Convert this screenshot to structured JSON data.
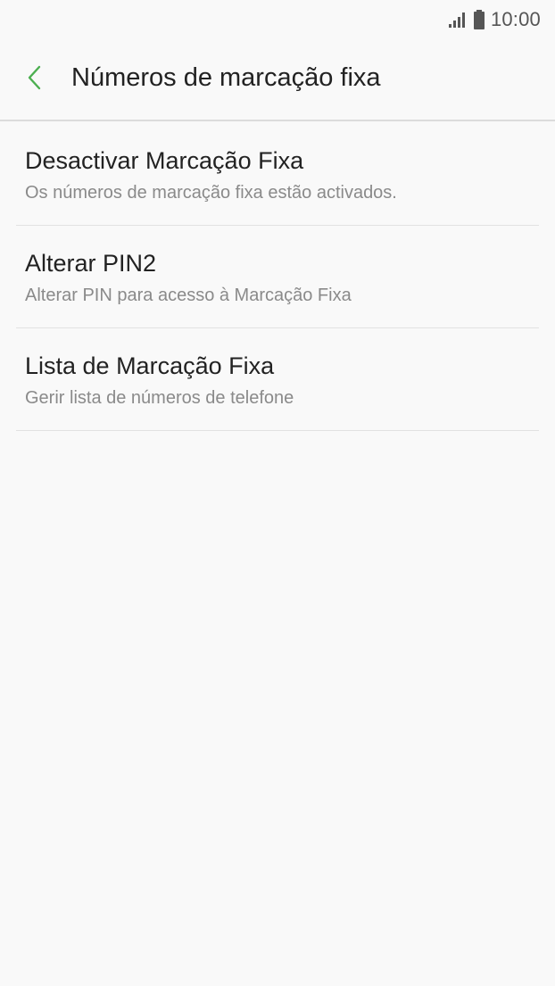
{
  "status_bar": {
    "time": "10:00",
    "signal_icon": "signal-icon",
    "battery_icon": "battery-icon"
  },
  "header": {
    "back_icon": "chevron-left-icon",
    "title": "Números de marcação fixa",
    "accent_color": "#4caf50"
  },
  "items": [
    {
      "title": "Desactivar Marcação Fixa",
      "subtitle": "Os números de marcação fixa estão activados."
    },
    {
      "title": "Alterar PIN2",
      "subtitle": "Alterar PIN para acesso à Marcação Fixa"
    },
    {
      "title": "Lista de Marcação Fixa",
      "subtitle": "Gerir lista de números de telefone"
    }
  ]
}
